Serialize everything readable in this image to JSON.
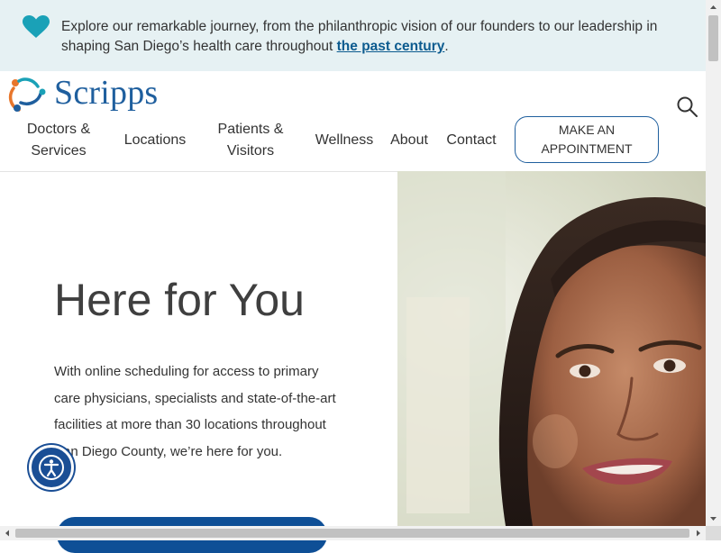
{
  "banner": {
    "text": "Explore our remarkable journey, from the philanthropic vision of our founders to our leadership in shaping San Diego’s health care throughout ",
    "link_text": "the past century",
    "trailing": ".",
    "icon": "heart-icon"
  },
  "header": {
    "logo_text": "Scripps",
    "search_icon": "search-icon",
    "nav": {
      "doctors_line1": "Doctors &",
      "doctors_line2": "Services",
      "locations": "Locations",
      "patients_line1": "Patients &",
      "patients_line2": "Visitors",
      "wellness": "Wellness",
      "about": "About",
      "contact": "Contact"
    },
    "appointment_line1": "MAKE AN",
    "appointment_line2": "APPOINTMENT"
  },
  "hero": {
    "title": "Here for You",
    "body": "With online scheduling for access to primary care physicians, specialists and state-of-the-art facilities at more than 30 locations throughout San Diego County, we’re here for you."
  },
  "colors": {
    "brand_blue": "#1f5f9e",
    "link_blue": "#0c5b8f",
    "heart_teal": "#1aa1b7",
    "banner_bg": "#e6f1f3",
    "cta_blue": "#0e4f96"
  }
}
